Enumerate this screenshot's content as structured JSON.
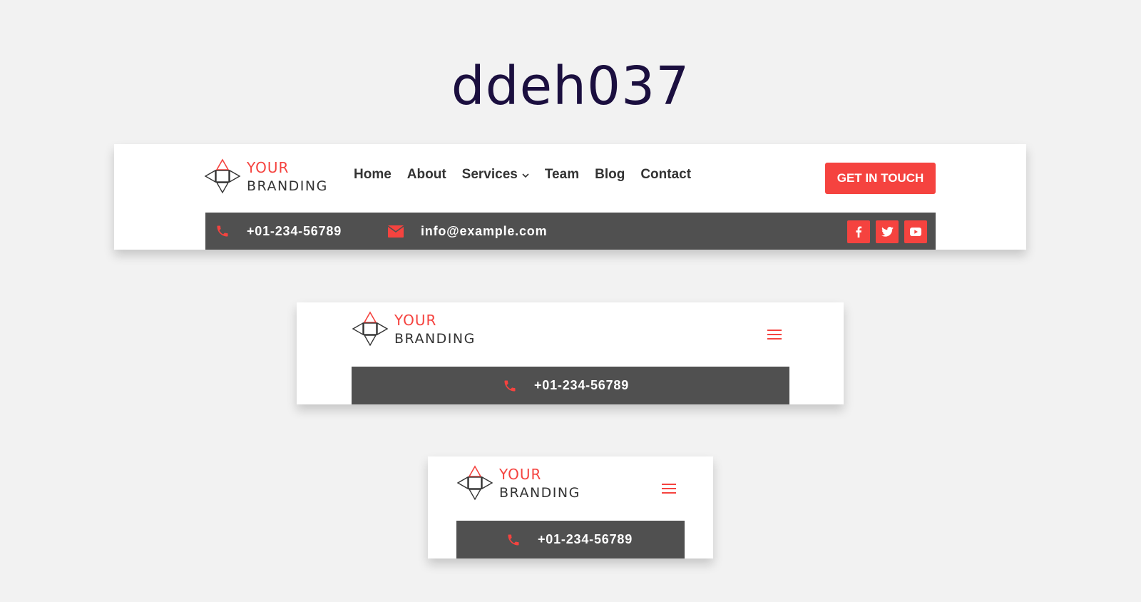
{
  "page": {
    "title": "ddeh037"
  },
  "brand": {
    "line1": "YOUR",
    "line2": "BRANDING",
    "accent": "#f5433f",
    "dark_bar": "#505050"
  },
  "nav": {
    "items": [
      {
        "label": "Home"
      },
      {
        "label": "About"
      },
      {
        "label": "Services",
        "has_dropdown": true,
        "dropdown_icon": "chevron-down-icon"
      },
      {
        "label": "Team"
      },
      {
        "label": "Blog"
      },
      {
        "label": "Contact"
      }
    ]
  },
  "cta": {
    "label": "GET IN TOUCH"
  },
  "contact": {
    "phone": "+01-234-56789",
    "phone_icon": "phone-icon",
    "email": "info@example.com",
    "email_icon": "envelope-icon"
  },
  "social": [
    {
      "icon": "facebook-icon"
    },
    {
      "icon": "twitter-icon"
    },
    {
      "icon": "youtube-icon"
    }
  ],
  "mobile_menu_icon": "hamburger-icon"
}
